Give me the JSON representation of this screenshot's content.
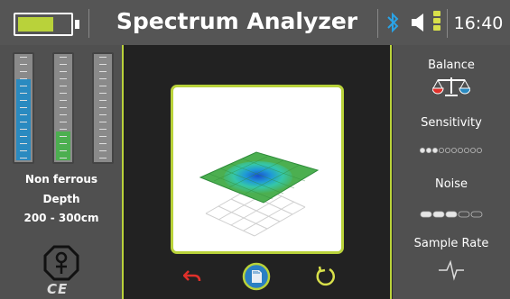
{
  "header": {
    "title": "Spectrum Analyzer",
    "time": "16:40",
    "battery_level": 0.7,
    "volume_bars": 3,
    "icons": [
      "battery-icon",
      "bluetooth-icon",
      "speaker-icon",
      "volume-level-icon"
    ]
  },
  "left_panel": {
    "gauges": [
      {
        "name": "gauge-blue",
        "level": 0.78,
        "color": "#2a8ac0"
      },
      {
        "name": "gauge-green",
        "level": 0.28,
        "color": "#4caf50"
      },
      {
        "name": "gauge-empty",
        "level": 0.0,
        "color": "#cccccc"
      }
    ],
    "metal_type": "Non ferrous",
    "depth_label": "Depth",
    "depth_value": "200 - 300cm",
    "logo_text": "CE"
  },
  "center": {
    "controls": [
      "undo-icon",
      "sd-card-icon",
      "refresh-icon"
    ]
  },
  "right_panel": {
    "balance_label": "Balance",
    "sensitivity_label": "Sensitivity",
    "sensitivity_level": 3,
    "sensitivity_max": 10,
    "noise_label": "Noise",
    "noise_level": 3,
    "noise_max": 5,
    "sample_rate_label": "Sample Rate"
  },
  "colors": {
    "accent": "#b9d23a",
    "blue": "#2a8ac0",
    "green": "#4caf50",
    "red": "#e0302a"
  }
}
